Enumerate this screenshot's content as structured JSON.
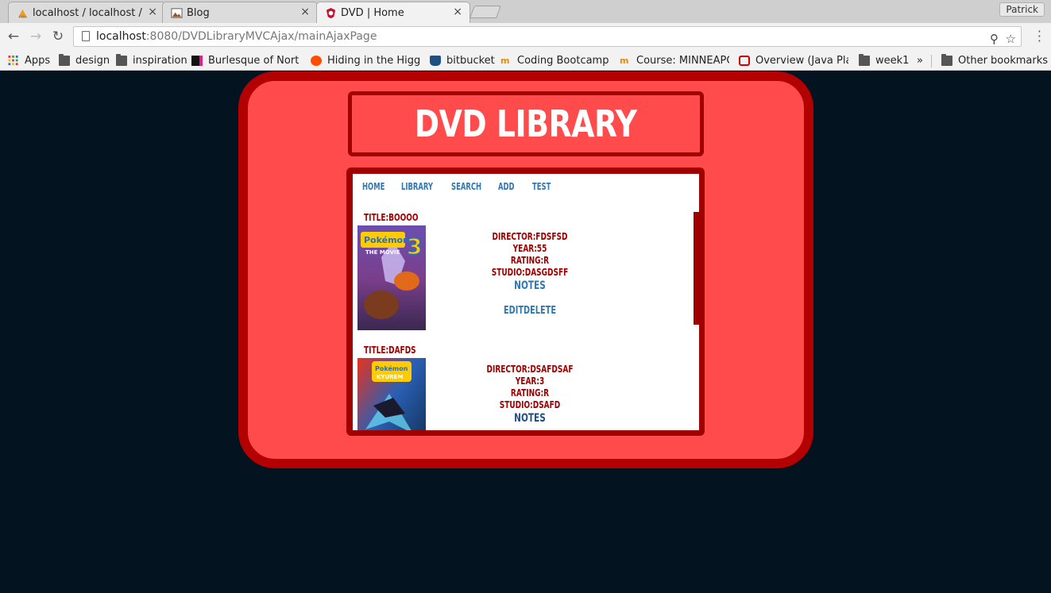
{
  "browser": {
    "tabs": [
      {
        "label": "localhost / localhost /",
        "close": "×"
      },
      {
        "label": "Blog",
        "close": "×"
      },
      {
        "label": "DVD  |  Home",
        "close": "×"
      }
    ],
    "profile": "Patrick",
    "url_host": "localhost",
    "url_rest": ":8080/DVDLibraryMVCAjax/mainAjaxPage",
    "bookmarks": [
      "Apps",
      "design",
      "inspiration",
      "Burlesque of North",
      "Hiding in the Higgs",
      "bitbucket",
      "Coding Bootcamp: I",
      "Course: MINNEAPOL",
      "Overview (Java Plat",
      "week1",
      "Other bookmarks"
    ],
    "overflow": "»"
  },
  "page": {
    "title": "DVD LIBRARY",
    "nav": [
      "HOME",
      "LIBRARY",
      "SEARCH",
      "ADD",
      "TEST"
    ],
    "dvds": [
      {
        "title": "TITLE:BOOOO",
        "director": "DIRECTOR:FDSFSD",
        "year": "YEAR:55",
        "rating": "RATING:R",
        "studio": "STUDIO:DASGDSFF",
        "notes": "NOTES",
        "edit": "EDIT",
        "delete": "DELETE"
      },
      {
        "title": "TITLE:DAFDS",
        "director": "DIRECTOR:DSAFDSAF",
        "year": "YEAR:3",
        "rating": "RATING:R",
        "studio": "STUDIO:DSAFD",
        "notes": "NOTES"
      }
    ]
  },
  "colors": {
    "background": "#031320",
    "card": "#ff4b4b",
    "card_border": "#b30000",
    "label_red": "#a00000",
    "link_blue": "#3377b0"
  }
}
